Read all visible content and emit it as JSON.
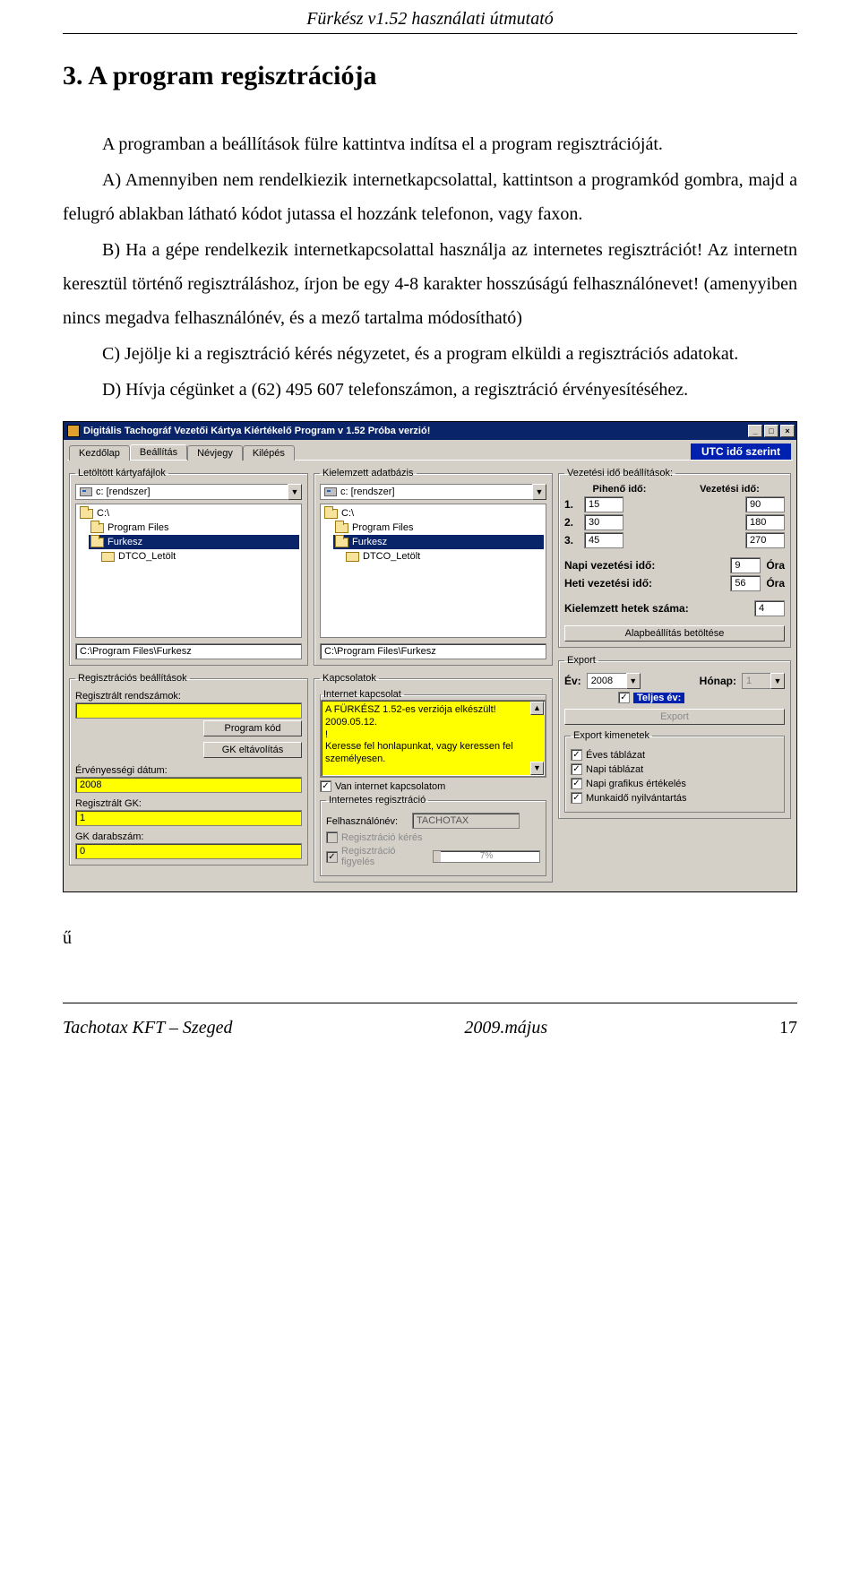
{
  "doc": {
    "header": "Fürkész v1.52 használati útmutató",
    "section_title": "3. A program regisztrációja",
    "p1": "A programban a beállítások fülre kattintva indítsa el a program regisztrációját.",
    "p2": "A) Amennyiben nem rendelkiezik internetkapcsolattal, kattintson a programkód gombra, majd a felugró ablakban látható kódot jutassa el hozzánk telefonon, vagy faxon.",
    "p3": "B) Ha a gépe rendelkezik internetkapcsolattal használja az internetes regisztrációt! Az internetn keresztül történő regisztráláshoz, írjon be egy 4-8 karakter hosszúságú felhasználónevet! (amenyyiben nincs megadva felhasználónév, és a mező tartalma módosítható)",
    "p4": "C) Jejölje ki a regisztráció kérés négyzetet, és a program elküldi a regisztrációs adatokat.",
    "p5": "D) Hívja cégünket a (62) 495 607 telefonszámon, a regisztráció érvényesítéséhez.",
    "lone": "ű",
    "footer_left": "Tachotax KFT – Szeged",
    "footer_mid": "2009.május",
    "footer_page": "17"
  },
  "app": {
    "title": "Digitális Tachográf Vezetői Kártya Kiértékelő Program   v 1.52   Próba verzió!",
    "winbtns": {
      "min": "_",
      "max": "□",
      "close": "×"
    },
    "tabs": [
      "Kezdőlap",
      "Beállítás",
      "Névjegy",
      "Kilépés"
    ],
    "active_tab": 1,
    "utc_badge": "UTC idő szerint",
    "groups": {
      "downloaded": {
        "legend": "Letöltött kártyafájlok",
        "drive": "c: [rendszer]",
        "dirs": [
          "C:\\",
          "Program Files",
          "Furkesz",
          "DTCO_Letölt"
        ],
        "selected_idx": 2,
        "path": "C:\\Program Files\\Furkesz"
      },
      "selecteddb": {
        "legend": "Kielemzett adatbázis",
        "drive": "c: [rendszer]",
        "dirs": [
          "C:\\",
          "Program Files",
          "Furkesz",
          "DTCO_Letölt"
        ],
        "selected_idx": 2,
        "path": "C:\\Program Files\\Furkesz"
      },
      "vezetes": {
        "legend": "Vezetési idő beállítások:",
        "col1": "Pihenő idő:",
        "col2": "Vezetési idő:",
        "rows": [
          {
            "idx": "1.",
            "a": "15",
            "b": "90"
          },
          {
            "idx": "2.",
            "a": "30",
            "b": "180"
          },
          {
            "idx": "3.",
            "a": "45",
            "b": "270"
          }
        ],
        "napi_lbl": "Napi vezetési idő:",
        "napi_val": "9",
        "heti_lbl": "Heti vezetési idő:",
        "heti_val": "56",
        "ora": "Óra",
        "hetek_lbl": "Kielemzett hetek száma:",
        "hetek_val": "4",
        "default_btn": "Alapbeállítás betöltése"
      },
      "reg": {
        "legend": "Regisztrációs beállítások",
        "serials_lbl": "Regisztrált rendszámok:",
        "btn_code": "Program kód",
        "btn_remove": "GK eltávolítás",
        "erv_lbl": "Érvényességi dátum:",
        "erv_val": "2008",
        "reggk_lbl": "Regisztrált GK:",
        "reggk_val": "1",
        "gkdb_lbl": "GK darabszám:",
        "gkdb_val": "0"
      },
      "kap": {
        "legend": "Kapcsolatok",
        "inner_legend": "Internet kapcsolat",
        "msg1": "A FÜRKÉSZ 1.52-es verziója elkészült!   2009.05.12.",
        "msg2": "!",
        "msg3": "Keresse fel honlapunkat, vagy keressen fel személyesen.",
        "van_label": "Van internet kapcsolatom",
        "reg_legend": "Internetes regisztráció",
        "user_lbl": "Felhasználónév:",
        "user_val": "TACHOTAX",
        "req_lbl": "Regisztráció kérés",
        "watch_lbl": "Regisztráció figyelés",
        "progress": "7%"
      },
      "export": {
        "legend": "Export",
        "ev_lbl": "Év:",
        "ev_val": "2008",
        "honap_lbl": "Hónap:",
        "honap_val": "1",
        "teljes_lbl": "Teljes év:",
        "btn": "Export",
        "kim_legend": "Export kimenetek",
        "c1": "Éves táblázat",
        "c2": "Napi táblázat",
        "c3": "Napi grafikus értékelés",
        "c4": "Munkaidő nyilvántartás"
      }
    }
  }
}
